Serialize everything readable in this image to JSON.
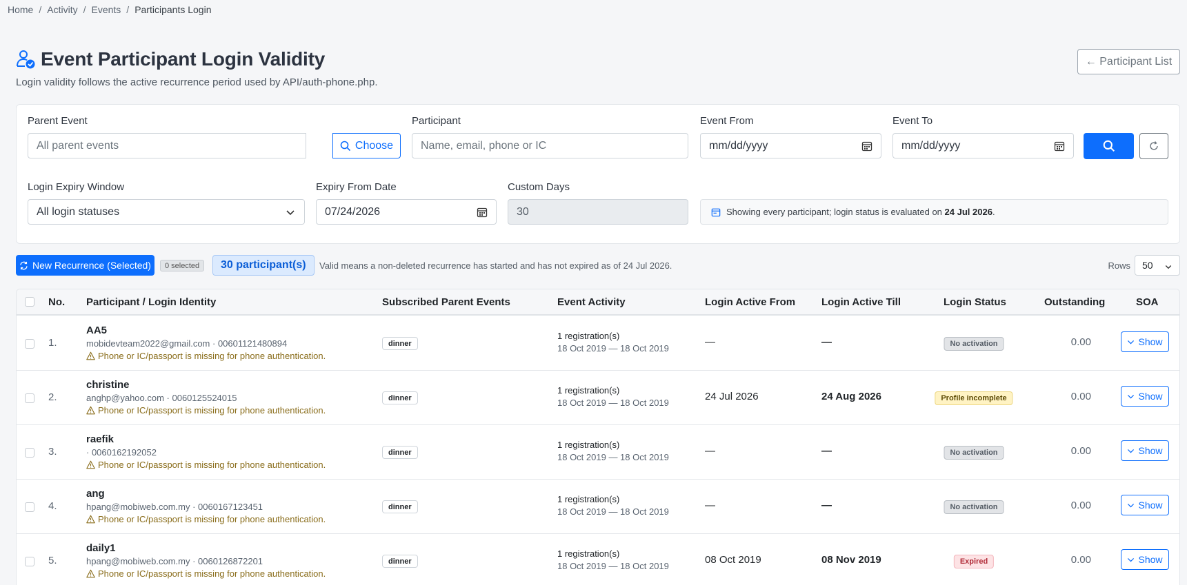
{
  "breadcrumb": [
    "Home",
    "Activity",
    "Events",
    "Participants Login"
  ],
  "header": {
    "title": "Event Participant Login Validity",
    "subtitle": "Login validity follows the active recurrence period used by API/auth-phone.php.",
    "participant_list_button": "← Participant List"
  },
  "filters": {
    "parent_event_label": "Parent Event",
    "parent_event_placeholder": "All parent events",
    "choose_label": "Choose",
    "participant_label": "Participant",
    "participant_placeholder": "Name, email, phone or IC",
    "event_from_label": "Event From",
    "event_from_value": "mm/dd/yyyy",
    "event_to_label": "Event To",
    "event_to_value": "mm/dd/yyyy",
    "expiry_window_label": "Login Expiry Window",
    "expiry_window_value": "All login statuses",
    "expiry_from_label": "Expiry From Date",
    "expiry_from_value": "07/24/2026",
    "custom_days_label": "Custom Days",
    "custom_days_value": "30",
    "info_text": "Showing every participant; login status is evaluated on",
    "info_date": "24 Jul 2026",
    "info_end": "."
  },
  "toolbar": {
    "new_recurrence_label": "New Recurrence (Selected)",
    "selected_badge": "0 selected",
    "count_badge": "30 participant(s)",
    "note": "Valid means a non-deleted recurrence has started and has not expired as of 24 Jul 2026.",
    "rows_label": "Rows",
    "rows_value": "50"
  },
  "table": {
    "columns": [
      "No.",
      "Participant / Login Identity",
      "Subscribed Parent Events",
      "Event Activity",
      "Login Active From",
      "Login Active Till",
      "Login Status",
      "Outstanding",
      "SOA"
    ],
    "rows": [
      {
        "no": "1.",
        "name": "AA5",
        "contact": "mobidevteam2022@gmail.com · 00601121480894",
        "warning": "Phone or IC/passport is missing for phone authentication.",
        "event": "dinner",
        "activity_count": "1 registration(s)",
        "activity_range": "18 Oct 2019 — 18 Oct 2019",
        "active_from": "—",
        "active_till": "—",
        "status": "No activation",
        "outstanding": "0.00",
        "soa": "Show"
      },
      {
        "no": "2.",
        "name": "christine",
        "contact": "anghp@yahoo.com · 0060125524015",
        "warning": "Phone or IC/passport is missing for phone authentication.",
        "event": "dinner",
        "activity_count": "1 registration(s)",
        "activity_range": "18 Oct 2019 — 18 Oct 2019",
        "active_from": "24 Jul 2026",
        "active_till": "24 Aug 2026",
        "status": "Profile incomplete",
        "outstanding": "0.00",
        "soa": "Show"
      },
      {
        "no": "3.",
        "name": "raefik",
        "contact": "· 0060162192052",
        "warning": "Phone or IC/passport is missing for phone authentication.",
        "event": "dinner",
        "activity_count": "1 registration(s)",
        "activity_range": "18 Oct 2019 — 18 Oct 2019",
        "active_from": "—",
        "active_till": "—",
        "status": "No activation",
        "outstanding": "0.00",
        "soa": "Show"
      },
      {
        "no": "4.",
        "name": "ang",
        "contact": "hpang@mobiweb.com.my · 0060167123451",
        "warning": "Phone or IC/passport is missing for phone authentication.",
        "event": "dinner",
        "activity_count": "1 registration(s)",
        "activity_range": "18 Oct 2019 — 18 Oct 2019",
        "active_from": "—",
        "active_till": "—",
        "status": "No activation",
        "outstanding": "0.00",
        "soa": "Show"
      },
      {
        "no": "5.",
        "name": "daily1",
        "contact": "hpang@mobiweb.com.my · 0060126872201",
        "warning": "Phone or IC/passport is missing for phone authentication.",
        "event": "dinner",
        "activity_count": "1 registration(s)",
        "activity_range": "18 Oct 2019 — 18 Oct 2019",
        "active_from": "08 Oct 2019",
        "active_till": "08 Nov 2019",
        "status": "Expired",
        "outstanding": "0.00",
        "soa": "Show"
      }
    ]
  },
  "colors": {
    "primary": "#0d6efd",
    "warning_text": "#8a6d1b",
    "expired": "#b02a37"
  },
  "icons": [
    "user-check-icon",
    "arrow-left-icon",
    "search-icon",
    "calendar-icon",
    "chevron-down-icon",
    "refresh-icon",
    "calendar-range-icon",
    "warning-triangle-icon"
  ]
}
